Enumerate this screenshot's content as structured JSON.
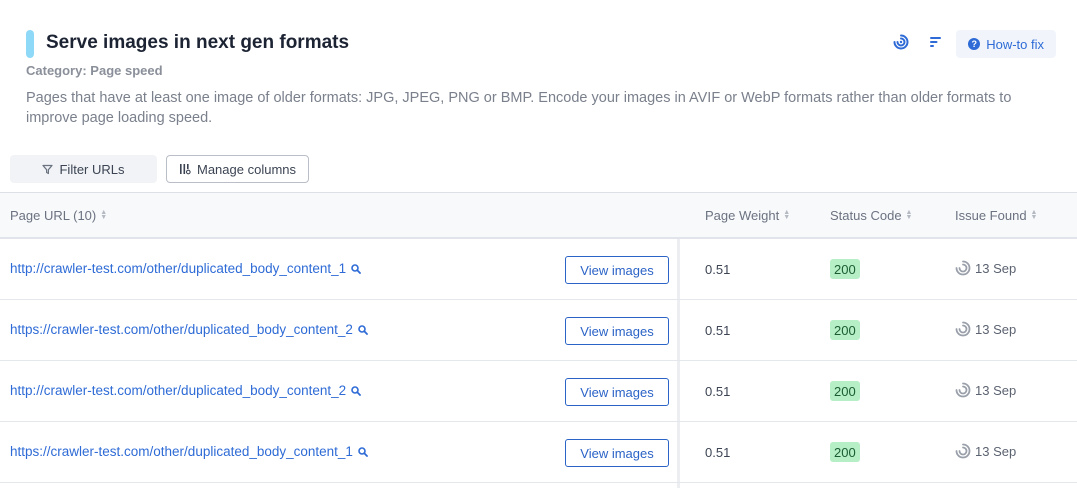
{
  "header": {
    "title": "Serve images in next gen formats",
    "category": "Category: Page speed",
    "description": "Pages that have at least one image of older formats: JPG, JPEG, PNG or BMP. Encode your images in AVIF or WebP formats rather than older formats to improve page loading speed.",
    "howto_label": "How-to fix",
    "accent_color": "#8ed8f8",
    "icons": [
      "history-icon",
      "sort-icon",
      "question-icon"
    ]
  },
  "toolbar": {
    "filter_label": "Filter URLs",
    "manage_label": "Manage columns",
    "icons": [
      "filter-icon",
      "columns-icon"
    ]
  },
  "table": {
    "columns": [
      "Page URL (10)",
      "Page Weight",
      "Status Code",
      "Issue Found"
    ],
    "view_label": "View images",
    "rows": [
      {
        "url": "http://crawler-test.com/other/duplicated_body_content_1",
        "weight": "0.51",
        "status": "200",
        "found": "13 Sep"
      },
      {
        "url": "https://crawler-test.com/other/duplicated_body_content_2",
        "weight": "0.51",
        "status": "200",
        "found": "13 Sep"
      },
      {
        "url": "http://crawler-test.com/other/duplicated_body_content_2",
        "weight": "0.51",
        "status": "200",
        "found": "13 Sep"
      },
      {
        "url": "https://crawler-test.com/other/duplicated_body_content_1",
        "weight": "0.51",
        "status": "200",
        "found": "13 Sep"
      }
    ]
  }
}
